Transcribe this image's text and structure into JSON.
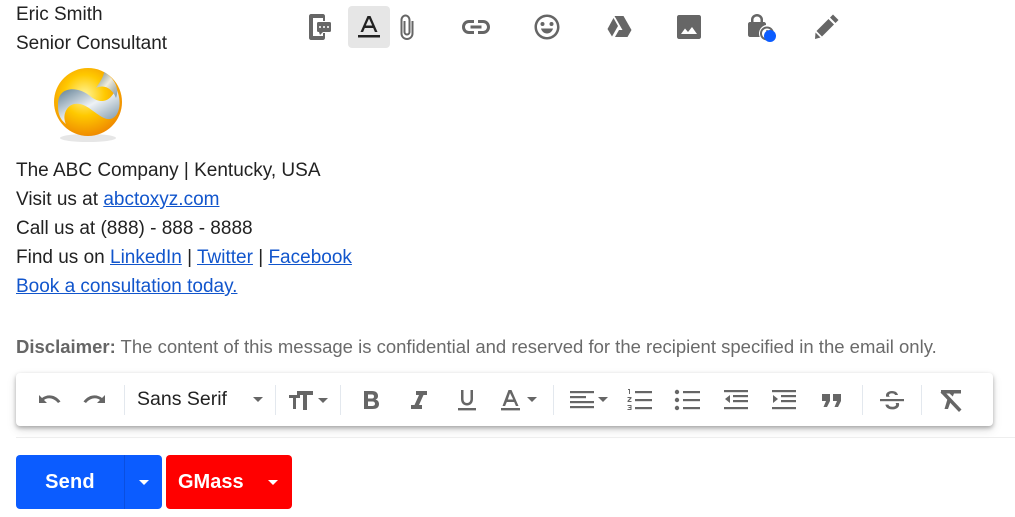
{
  "signature": {
    "name": "Eric Smith",
    "title": "Senior Consultant",
    "logo_alt": "Company logo",
    "company_line": "The ABC Company | Kentucky, USA",
    "visit_prefix": "Visit us at ",
    "website_link": "abctoxyz.com",
    "call_line": "Call us at (888) - 888 - 8888",
    "find_prefix": "Find us on ",
    "social_links": [
      "LinkedIn",
      "Twitter",
      "Facebook"
    ],
    "social_separator": " | ",
    "booking_link": "Book a consultation today."
  },
  "disclaimer": {
    "label": "Disclaimer:",
    "text": " The content of this message is confidential and reserved for the recipient specified in the email only."
  },
  "formatting_toolbar": {
    "font_family": "Sans Serif",
    "items": [
      {
        "icon": "undo-icon",
        "label": "Undo"
      },
      {
        "icon": "redo-icon",
        "label": "Redo"
      },
      {
        "icon": "font-family-select",
        "label": "Sans Serif"
      },
      {
        "icon": "text-size-icon",
        "label": "Size"
      },
      {
        "icon": "bold-icon",
        "label": "Bold"
      },
      {
        "icon": "italic-icon",
        "label": "Italic"
      },
      {
        "icon": "underline-icon",
        "label": "Underline"
      },
      {
        "icon": "text-color-icon",
        "label": "Text color"
      },
      {
        "icon": "align-icon",
        "label": "Align"
      },
      {
        "icon": "numbered-list-icon",
        "label": "Numbered list"
      },
      {
        "icon": "bulleted-list-icon",
        "label": "Bulleted list"
      },
      {
        "icon": "indent-less-icon",
        "label": "Indent less"
      },
      {
        "icon": "indent-more-icon",
        "label": "Indent more"
      },
      {
        "icon": "quote-icon",
        "label": "Quote"
      },
      {
        "icon": "strikethrough-icon",
        "label": "Strikethrough"
      },
      {
        "icon": "remove-formatting-icon",
        "label": "Remove formatting"
      }
    ]
  },
  "compose_actions": {
    "send_label": "Send",
    "gmass_label": "GMass",
    "accent_send": "#0b5cff",
    "accent_gmass": "#ff0000",
    "icons": [
      "sms-icon",
      "formatting-options-icon",
      "attach-icon",
      "link-icon",
      "emoji-icon",
      "drive-icon",
      "photo-icon",
      "confidential-mode-icon",
      "signature-icon"
    ]
  }
}
